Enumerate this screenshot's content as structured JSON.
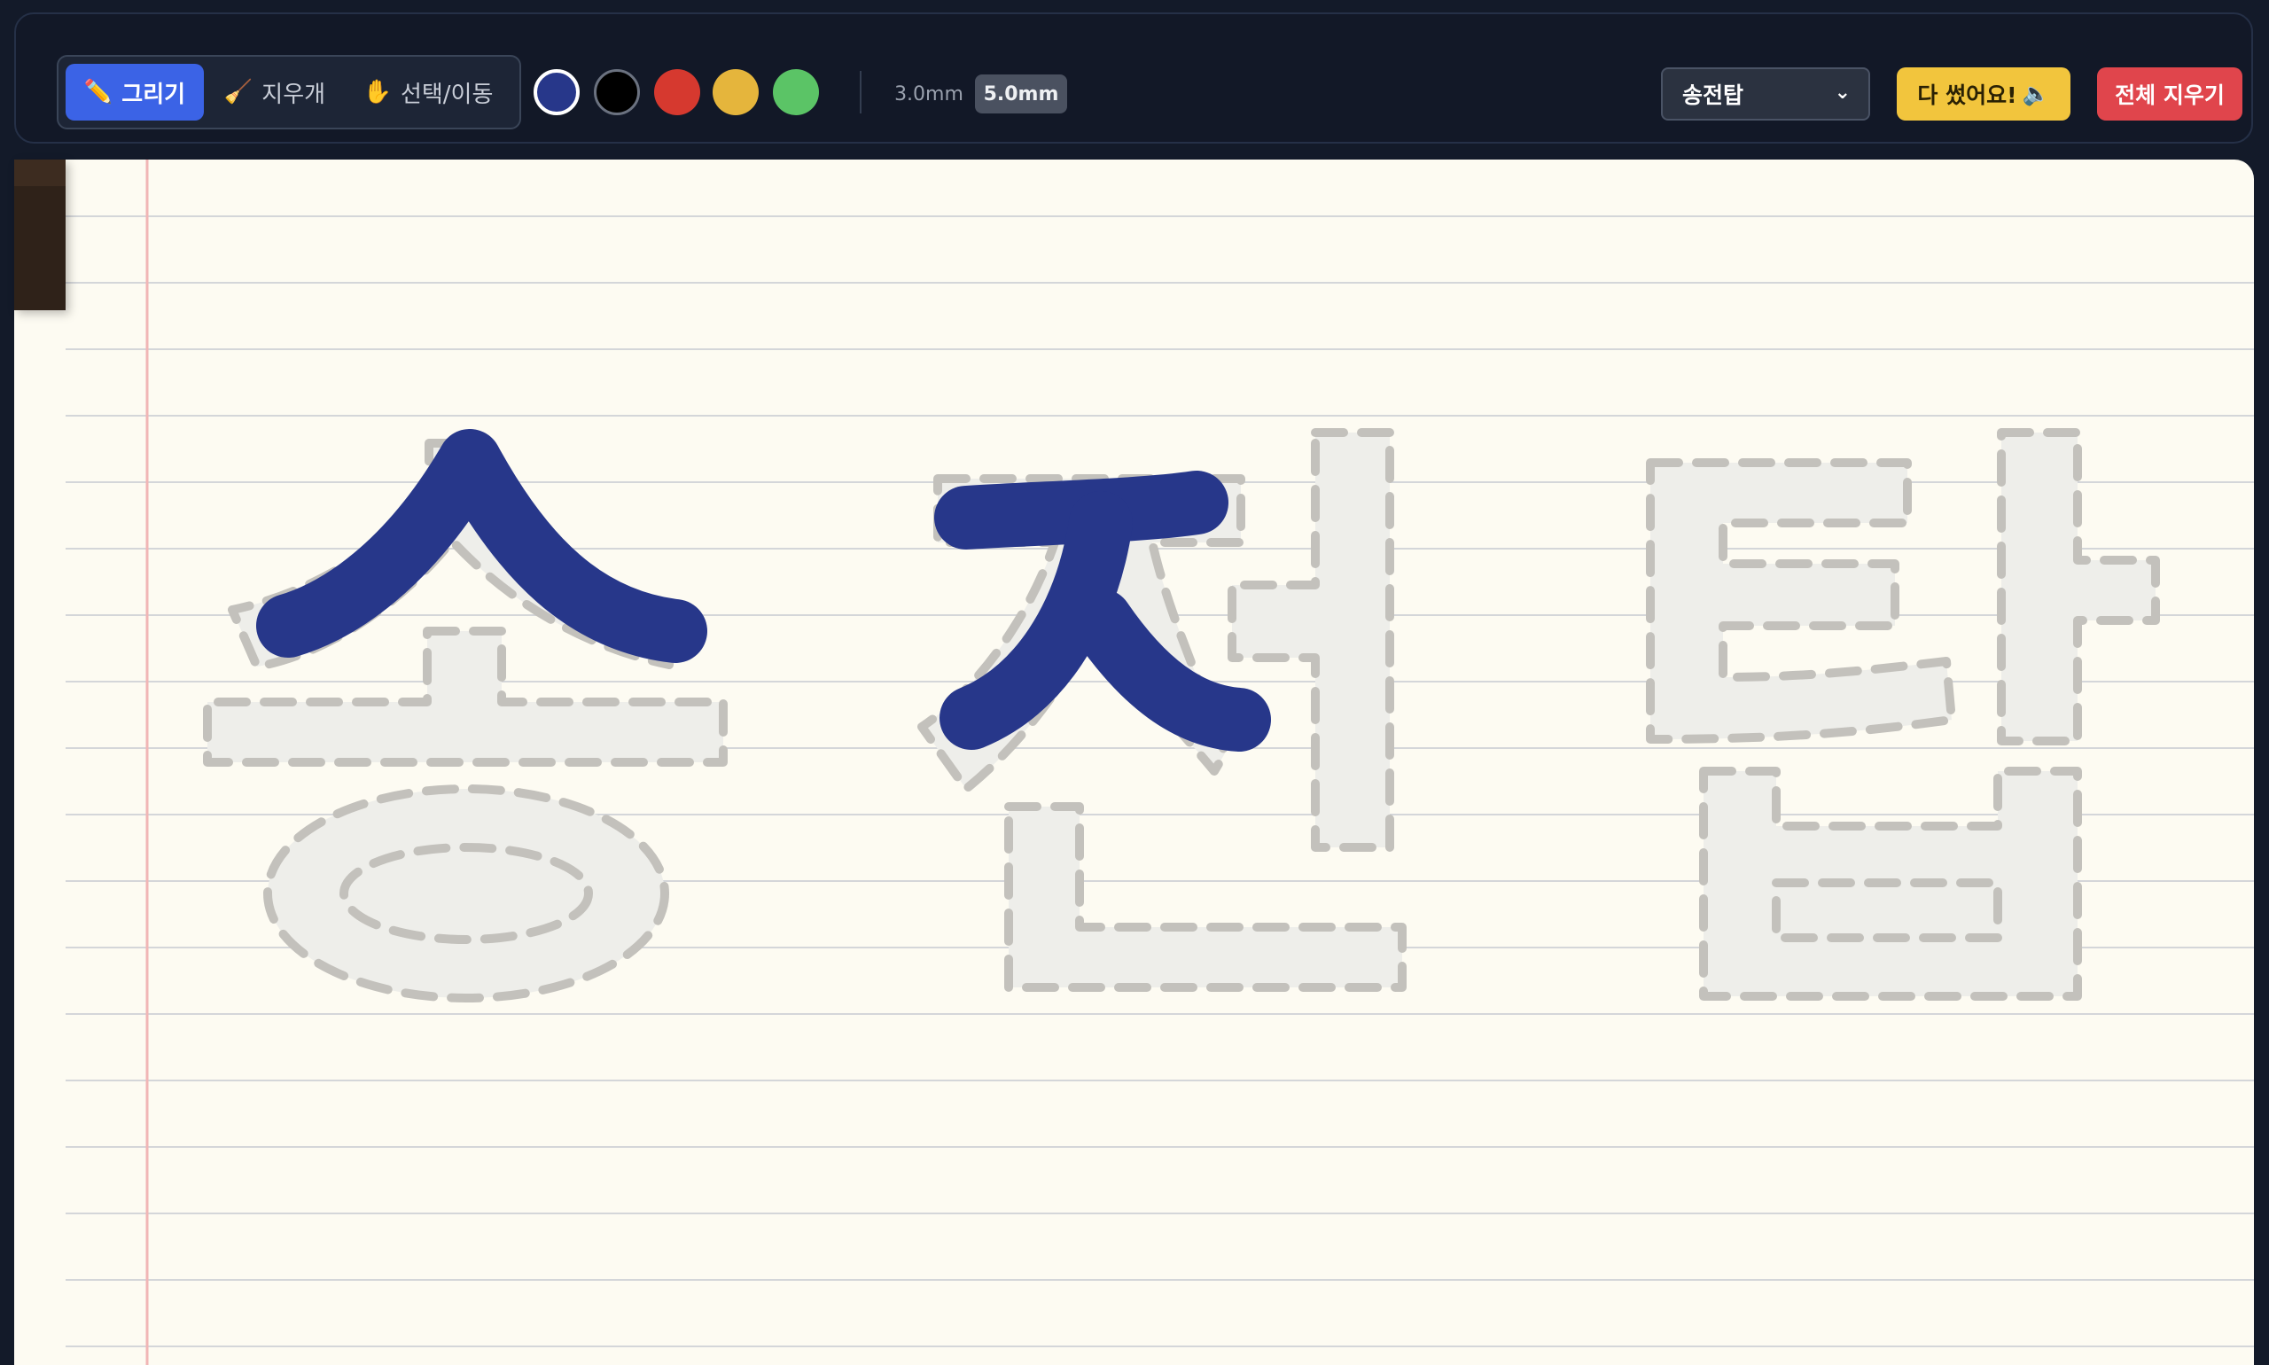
{
  "toolbar": {
    "tools": [
      {
        "icon": "✏️",
        "label": "그리기",
        "active": true
      },
      {
        "icon": "🧹",
        "label": "지우개",
        "active": false
      },
      {
        "icon": "✋",
        "label": "선택/이동",
        "active": false
      }
    ],
    "colors": [
      {
        "name": "navy",
        "hex": "#27378a",
        "selected": true
      },
      {
        "name": "black",
        "hex": "#000000",
        "selected": false
      },
      {
        "name": "red",
        "hex": "#d6392f",
        "selected": false
      },
      {
        "name": "yellow",
        "hex": "#e5b53c",
        "selected": false
      },
      {
        "name": "green",
        "hex": "#5bc466",
        "selected": false
      }
    ],
    "sizes": [
      {
        "label": "3.0mm",
        "active": false
      },
      {
        "label": "5.0mm",
        "active": true
      }
    ],
    "word_select": {
      "value": "송전탑",
      "icon": "chevron-down-icon"
    },
    "done_button": {
      "label": "다 썼어요!",
      "icon": "🔈"
    },
    "clear_button": {
      "label": "전체 지우기"
    }
  },
  "canvas": {
    "guide_word": "송전탑",
    "stroke_color": "#27378a",
    "guide_fill": "#eeeeea",
    "guide_dash_color": "#c3c1bc",
    "line_color": "#d4d6d9",
    "margin_color": "#f1b6b6",
    "paper_color": "#fdfbf2"
  }
}
